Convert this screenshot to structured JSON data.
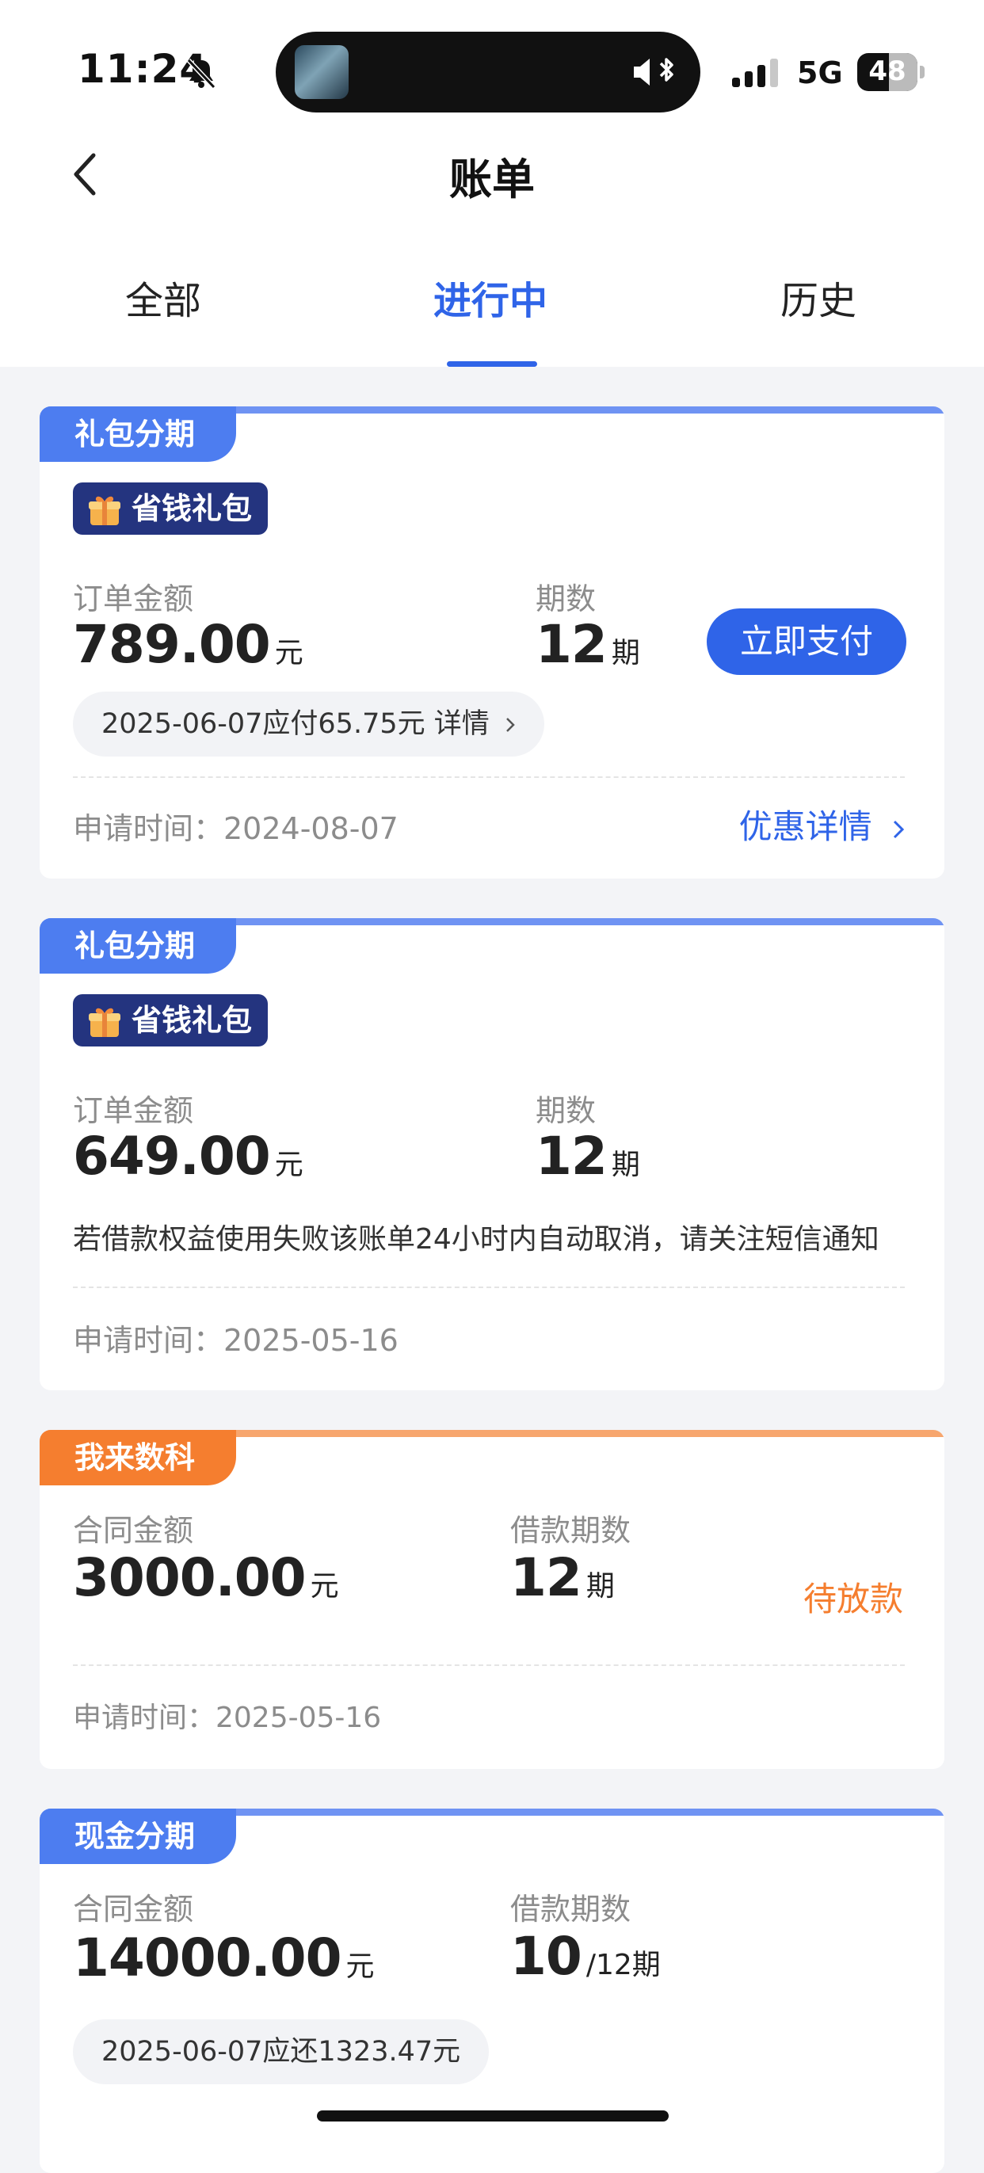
{
  "status_bar": {
    "time": "11:24",
    "network": "5G",
    "battery": "48"
  },
  "header": {
    "title": "账单"
  },
  "tabs": [
    {
      "label": "全部",
      "active": false
    },
    {
      "label": "进行中",
      "active": true
    },
    {
      "label": "历史",
      "active": false
    }
  ],
  "colors": {
    "accent": "#2f64e8",
    "tag_blue": "#4d7df0",
    "tag_orange": "#f57e2f",
    "gift_badge": "#24347f"
  },
  "cards": [
    {
      "tag": "礼包分期",
      "badge": "省钱礼包",
      "amount_label": "订单金额",
      "amount": "789.00",
      "amount_unit": "元",
      "term_label": "期数",
      "term": "12",
      "term_unit": "期",
      "pay_button": "立即支付",
      "due_text": "2025-06-07应付65.75元 详情",
      "apply_text": "申请时间：2024-08-07",
      "link_text": "优惠详情"
    },
    {
      "tag": "礼包分期",
      "badge": "省钱礼包",
      "amount_label": "订单金额",
      "amount": "649.00",
      "amount_unit": "元",
      "term_label": "期数",
      "term": "12",
      "term_unit": "期",
      "notice": "若借款权益使用失败该账单24小时内自动取消，请关注短信通知",
      "apply_text": "申请时间：2025-05-16"
    },
    {
      "tag": "我来数科",
      "amount_label": "合同金额",
      "amount": "3000.00",
      "amount_unit": "元",
      "term_label": "借款期数",
      "term": "12",
      "term_unit": "期",
      "status": "待放款",
      "apply_text": "申请时间：2025-05-16"
    },
    {
      "tag": "现金分期",
      "amount_label": "合同金额",
      "amount": "14000.00",
      "amount_unit": "元",
      "term_label": "借款期数",
      "term": "10",
      "term_unit": "/12期",
      "due_text": "2025-06-07应还1323.47元"
    }
  ],
  "icons": [
    "bell-slash-icon",
    "speaker-bluetooth-icon",
    "signal-icon",
    "battery-icon",
    "back-chevron-icon",
    "gift-icon",
    "chevron-right-icon"
  ]
}
